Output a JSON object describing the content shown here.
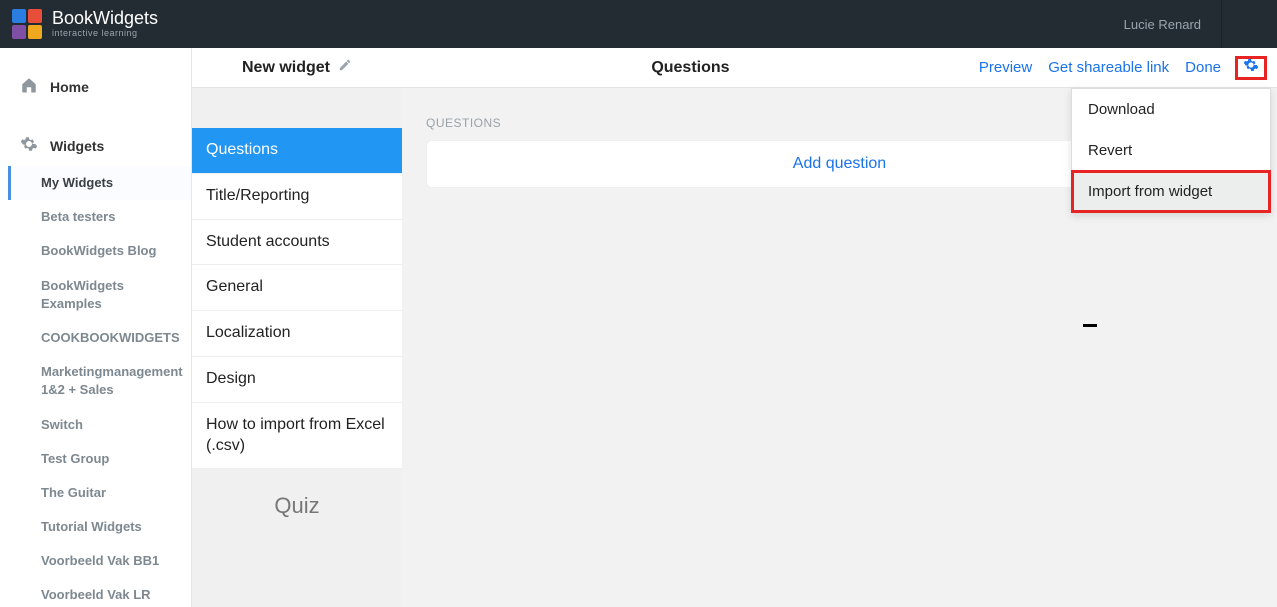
{
  "brand": {
    "name": "BookWidgets",
    "tagline": "interactive learning"
  },
  "user": {
    "name": "Lucie Renard"
  },
  "sidebar": {
    "home": "Home",
    "widgets": "Widgets",
    "items": [
      "My Widgets",
      "Beta testers",
      "BookWidgets Blog",
      "BookWidgets Examples",
      "COOKBOOKWIDGETS",
      "Marketingmanagement 1&2 + Sales",
      "Switch",
      "Test Group",
      "The Guitar",
      "Tutorial Widgets",
      "Voorbeeld Vak BB1",
      "Voorbeeld Vak LR"
    ],
    "active_index": 0
  },
  "midcol": {
    "title": "New widget",
    "items": [
      "Questions",
      "Title/Reporting",
      "Student accounts",
      "General",
      "Localization",
      "Design",
      "How to import from Excel (.csv)"
    ],
    "active_index": 0,
    "footer": "Quiz"
  },
  "editor": {
    "title": "Questions",
    "links": {
      "preview": "Preview",
      "share": "Get shareable link",
      "done": "Done"
    },
    "section_label": "QUESTIONS",
    "add_button": "Add question"
  },
  "menu": {
    "download": "Download",
    "revert": "Revert",
    "import": "Import from widget"
  }
}
